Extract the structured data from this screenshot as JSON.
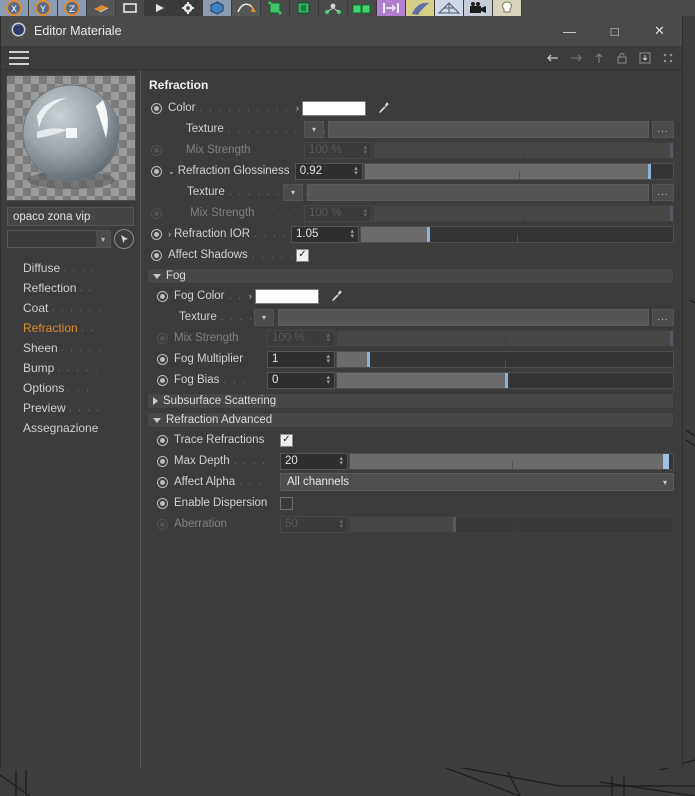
{
  "toolbar_icons": [
    {
      "name": "axis-x-icon"
    },
    {
      "name": "axis-y-icon"
    },
    {
      "name": "axis-z-icon"
    },
    {
      "name": "move-object-icon"
    },
    {
      "name": "render-region-icon"
    },
    {
      "name": "render-view-icon"
    },
    {
      "name": "render-settings-icon"
    },
    {
      "name": "cube-primitive-icon"
    },
    {
      "name": "spline-pen-icon"
    },
    {
      "name": "nurbs-extrude-icon"
    },
    {
      "name": "array-object-icon"
    },
    {
      "name": "deformer-icon"
    },
    {
      "name": "mograph-cloner-icon"
    },
    {
      "name": "mograph-effector-icon"
    },
    {
      "name": "hair-object-icon"
    },
    {
      "name": "scene-grid-icon"
    },
    {
      "name": "camera-icon"
    },
    {
      "name": "light-icon"
    }
  ],
  "window": {
    "title": "Editor Materiale",
    "app_icon": "material-sphere-icon",
    "minimize": "—",
    "maximize": "□",
    "close": "✕"
  },
  "menubar": {
    "hamburger": "menu-icon",
    "icons": [
      {
        "name": "nav-back-icon",
        "glyph": "←"
      },
      {
        "name": "nav-forward-icon",
        "glyph": "→"
      },
      {
        "name": "nav-up-icon",
        "glyph": "↑"
      },
      {
        "name": "lock-icon",
        "glyph": "🔓"
      },
      {
        "name": "pin-icon",
        "glyph": "⬇"
      },
      {
        "name": "options-icon",
        "glyph": "⁙"
      }
    ]
  },
  "sidebar": {
    "material_name": "opaco zona vip",
    "combo_value": "",
    "picker_icon": "pick-material-icon",
    "channels": [
      {
        "label": "Diffuse",
        "dots": ". . . .",
        "active": false
      },
      {
        "label": "Reflection",
        "dots": ". .",
        "active": false
      },
      {
        "label": "Coat",
        "dots": ". . . . . .",
        "active": false
      },
      {
        "label": "Refraction",
        "dots": ". .",
        "active": true
      },
      {
        "label": "Sheen",
        "dots": ". . . . .",
        "active": false
      },
      {
        "label": "Bump",
        "dots": ". . . . .",
        "active": false
      },
      {
        "label": "Options",
        "dots": ". . .",
        "active": false
      },
      {
        "label": "Preview",
        "dots": ". . . .",
        "active": false
      },
      {
        "label": "Assegnazione",
        "dots": "",
        "active": false
      }
    ]
  },
  "main": {
    "section_title": "Refraction",
    "color": {
      "label": "Color",
      "dots": ". . . . . . . . . .",
      "expand": "›",
      "value": "#ffffff",
      "eyedropper": "eyedropper-icon"
    },
    "texture1": {
      "label": "Texture",
      "dots": ". . . . . . . . . . .",
      "value": "",
      "browse": "..."
    },
    "mix1": {
      "label": "Mix Strength",
      "dots": ". . . . . . .",
      "value": "100 %",
      "fill": 100,
      "knob": 99
    },
    "glossiness": {
      "label": "Refraction Glossiness",
      "caret": "⌄",
      "value": "0.92",
      "fill": 92,
      "knob": 92
    },
    "texture2": {
      "label": "Texture",
      "dots": ". . . . . . . . .",
      "value": "",
      "browse": "..."
    },
    "mix2": {
      "label": "Mix Strength",
      "dots": ". . . . . .",
      "value": "100 %",
      "fill": 100,
      "knob": 99
    },
    "ior": {
      "label": "Refraction IOR",
      "caret": "›",
      "dots": ". . . .",
      "value": "1.05",
      "fill": 21,
      "knob": 21
    },
    "affect_shadows": {
      "label": "Affect Shadows",
      "dots": ". . . . . .",
      "checked": true
    },
    "fog_group": {
      "label": "Fog",
      "expanded": true
    },
    "fog_color": {
      "label": "Fog Color",
      "dots": ". .",
      "expand": "›",
      "value": "#ffffff",
      "eyedropper": "eyedropper-icon"
    },
    "fog_texture": {
      "label": "Texture",
      "dots": ". . . .",
      "value": "",
      "browse": "..."
    },
    "fog_mix": {
      "label": "Mix Strength",
      "dots": "",
      "value": "100 %",
      "fill": 100,
      "knob": 99
    },
    "fog_multiplier": {
      "label": "Fog Multiplier",
      "dots": "",
      "value": "1",
      "fill": 9,
      "knob": 9
    },
    "fog_bias": {
      "label": "Fog Bias",
      "dots": ". . .",
      "value": "0",
      "fill": 50,
      "knob": 50
    },
    "sss_group": {
      "label": "Subsurface Scattering",
      "expanded": false
    },
    "advanced_group": {
      "label": "Refraction Advanced",
      "expanded": true
    },
    "trace_refractions": {
      "label": "Trace Refractions",
      "dots": "",
      "checked": true
    },
    "max_depth": {
      "label": "Max Depth",
      "dots": ". . . .",
      "value": "20",
      "fill": 98,
      "knob": 97
    },
    "affect_alpha": {
      "label": "Affect Alpha",
      "dots": ". . .",
      "value": "All channels",
      "arrow": "⌄"
    },
    "enable_dispersion": {
      "label": "Enable Dispersion",
      "dots": "",
      "checked": false
    },
    "aberration": {
      "label": "Aberration",
      "dots": ". . . . .",
      "value": "50",
      "fill": 32,
      "knob": 32
    }
  },
  "colors": {
    "accent_active": "#e08a2e",
    "slider_knob": "#8ab4dd",
    "panel_bg": "#3c3c3c",
    "titlebar_bg": "#4a4a4a"
  }
}
